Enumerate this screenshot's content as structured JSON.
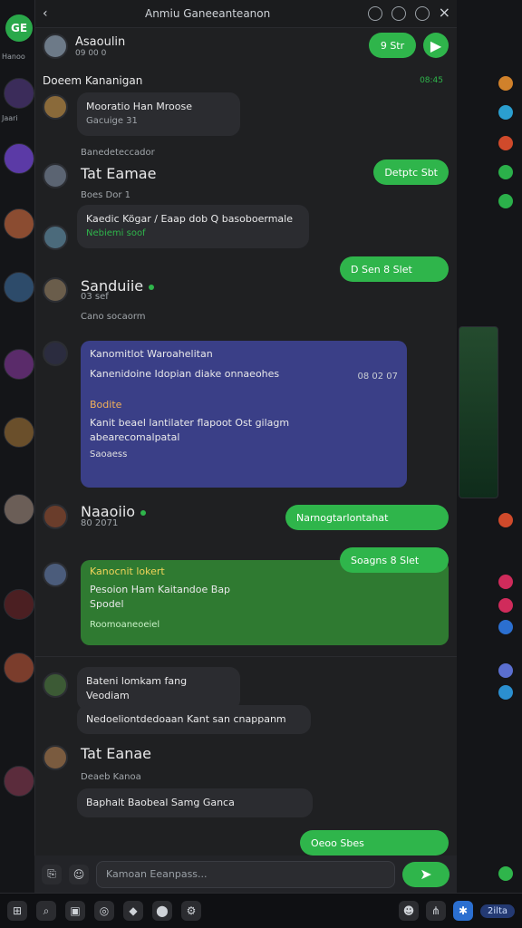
{
  "titlebar": {
    "title": "Anmiu Ganeeanteanon"
  },
  "header": {
    "contact_name": "Asaoulin",
    "contact_subtitle": "09 00 0",
    "call_label": "9 Str"
  },
  "section": {
    "title": "Doeem Kananigan",
    "time": "08:45"
  },
  "messages": [
    {
      "name": "Mooratio Han Mroose",
      "meta": "Gacuige 31",
      "line": "Banedeteccador"
    },
    {
      "name": "Tat Eamae",
      "meta": "Boes Dor 1"
    },
    {
      "text": "Kaedic Kögar / Eaap dob Q basoboermale",
      "foot": "Nebiemi soof"
    },
    {
      "name": "Sanduiie",
      "meta": "03 sef",
      "line": "Cano socaorm"
    },
    {
      "name": "Kanomitlot Waroahelitan",
      "text": "Kanenidoine Idopian diake onnaeohes",
      "time": "08 02 07"
    },
    {
      "card_title": "Bodite",
      "card_text": "Kanit beael lantilater flapoot Ost gilagm",
      "card_sub": "abearecomalpatal",
      "card_tag": "Saoaess"
    },
    {
      "name": "Naaoiio",
      "meta": "80 2071",
      "out": "Narnogtarlontahat"
    },
    {
      "name": "Kanocnit lokert",
      "text": "Pesoion Ham Kaitandoe Bap",
      "sub": "Spodel",
      "foot": "Roomoaneoeiel"
    },
    {
      "name": "Bateni lomkam fang Veodiam",
      "line": "Nedoeliontdedoaan Kant san cnappanm"
    },
    {
      "name": "Tat Eanae",
      "meta": "Deaeb Kanoa"
    },
    {
      "text": "Baphalt Baobeal Samg Ganca"
    }
  ],
  "outgoing": [
    {
      "text": "Detptc Sbt"
    },
    {
      "text": "D Sen 8 Slet"
    },
    {
      "text": "Soagns 8 Slet"
    },
    {
      "text": "Oeoo Sbes"
    }
  ],
  "input": {
    "placeholder": "Kamoan Eeanpass..."
  },
  "taskbar": {
    "right_pill": "2ilta"
  }
}
